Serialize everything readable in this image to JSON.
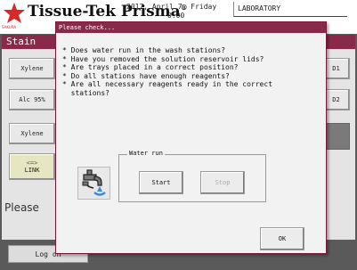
{
  "header": {
    "brand": "Tissue-Tek Prisma",
    "brand_mark": "®",
    "brand_sub": "SAKURA",
    "date": "2017, April 7, Friday",
    "time": "0:00",
    "lab": "LABORATORY"
  },
  "app": {
    "section_title": "Stain",
    "left_buttons": [
      "Xylene",
      "Alc 95%",
      "Xylene"
    ],
    "link_button": {
      "arrows": "<=>",
      "label": "LINK"
    },
    "right_buttons": [
      "D1",
      "D2"
    ],
    "prompt": "Please",
    "login_label": "Log on"
  },
  "dialog": {
    "title": "Please check...",
    "checks": [
      "* Does water run in the wash stations?",
      "* Have you removed the solution reservoir lids?",
      "* Are trays placed in a correct position?",
      "* Do all stations have enough reagents?",
      "* Are all necessary reagents ready in the correct",
      "  stations?"
    ],
    "water_group_label": "Water run",
    "start_label": "Start",
    "stop_label": "Stop",
    "ok_label": "OK"
  },
  "icons": {
    "logo": "star-logo-icon",
    "water": "water-faucet-icon"
  },
  "colors": {
    "accent": "#8a2a4a",
    "logo": "#d42a2a"
  }
}
